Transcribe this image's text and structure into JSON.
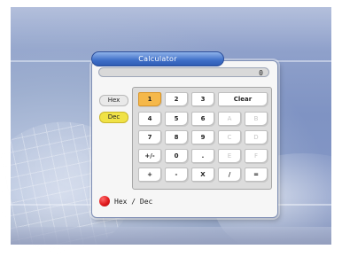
{
  "window": {
    "title": "Calculator"
  },
  "display": {
    "value": "0"
  },
  "mode": {
    "hex_label": "Hex",
    "dec_label": "Dec",
    "selected": "Dec"
  },
  "keys": [
    {
      "label": "1",
      "state": "selected"
    },
    {
      "label": "2",
      "state": "enabled"
    },
    {
      "label": "3",
      "state": "enabled"
    },
    {
      "label": "Clear",
      "state": "enabled"
    },
    {
      "label": "4",
      "state": "enabled"
    },
    {
      "label": "5",
      "state": "enabled"
    },
    {
      "label": "6",
      "state": "enabled"
    },
    {
      "label": "A",
      "state": "disabled"
    },
    {
      "label": "B",
      "state": "disabled"
    },
    {
      "label": "7",
      "state": "enabled"
    },
    {
      "label": "8",
      "state": "enabled"
    },
    {
      "label": "9",
      "state": "enabled"
    },
    {
      "label": "C",
      "state": "disabled"
    },
    {
      "label": "D",
      "state": "disabled"
    },
    {
      "label": "+/-",
      "state": "enabled"
    },
    {
      "label": "0",
      "state": "enabled"
    },
    {
      "label": ".",
      "state": "enabled"
    },
    {
      "label": "E",
      "state": "disabled"
    },
    {
      "label": "F",
      "state": "disabled"
    },
    {
      "label": "+",
      "state": "enabled"
    },
    {
      "label": "-",
      "state": "enabled"
    },
    {
      "label": "X",
      "state": "enabled"
    },
    {
      "label": "/",
      "state": "enabled"
    },
    {
      "label": "=",
      "state": "enabled"
    }
  ],
  "legend": {
    "icon": "red-button-icon",
    "label": "Hex / Dec",
    "color": "#e0191c"
  },
  "colors": {
    "title_bar": "#3f6fc8",
    "selected_key": "#f5b84a",
    "dec_mode": "#f0e246",
    "background": "#8799c6"
  }
}
